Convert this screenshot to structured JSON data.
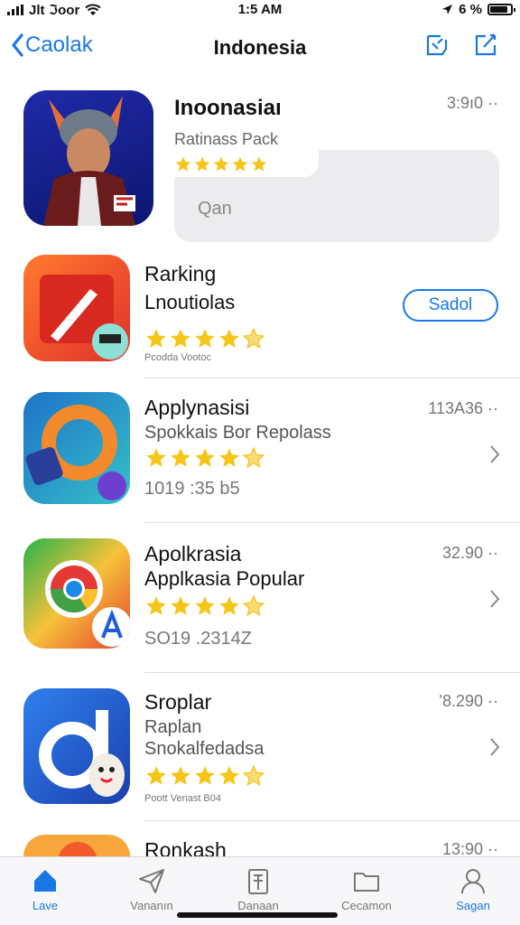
{
  "status": {
    "carrier": "Jlt ℑoor",
    "time": "1:5 AM",
    "battery": "6 %"
  },
  "nav": {
    "back_label": "Caolak",
    "title": "Indonesia"
  },
  "featured": {
    "name": "Inoonasiaı",
    "time": "3:9ı0 ··",
    "subtitle": "Ratinass Pack",
    "rating": 5,
    "search_placeholder": "Qan"
  },
  "rows": [
    {
      "title": "Rarking",
      "subtitle": "Lnoutiolas",
      "meta": "Pcodda Vootoc",
      "action": "Sadol",
      "rating": 4.5
    },
    {
      "title": "Applynasisi",
      "subtitle": "Spokkais Bor Repolass",
      "meta": "1019 :35 b5",
      "price": "113A36 ··",
      "rating": 4.5
    },
    {
      "title": "Apolkrasia",
      "subtitle": "Applkasia Popular",
      "meta": "SO19 .2314Z",
      "price": "32.90 ··",
      "rating": 4.5
    },
    {
      "title": "Sroplar",
      "subtitle": "Raplan",
      "subtitle2": "Snokalfedadsa",
      "meta": "Poott Venast B04",
      "price": "'8.290 ··",
      "rating": 4.5
    },
    {
      "title": "Ronkash",
      "price": "13:90 ··"
    }
  ],
  "tabs": [
    {
      "label": "Lave",
      "icon": "home-icon",
      "active": true
    },
    {
      "label": "Vananın",
      "icon": "paper-plane-icon",
      "active": false
    },
    {
      "label": "Danaan",
      "icon": "document-icon",
      "active": false
    },
    {
      "label": "Cecamon",
      "icon": "folder-icon",
      "active": false
    },
    {
      "label": "Sagan",
      "icon": "person-icon",
      "active": true
    }
  ],
  "colors": {
    "accent": "#1a78e6",
    "star": "#f5c518"
  }
}
